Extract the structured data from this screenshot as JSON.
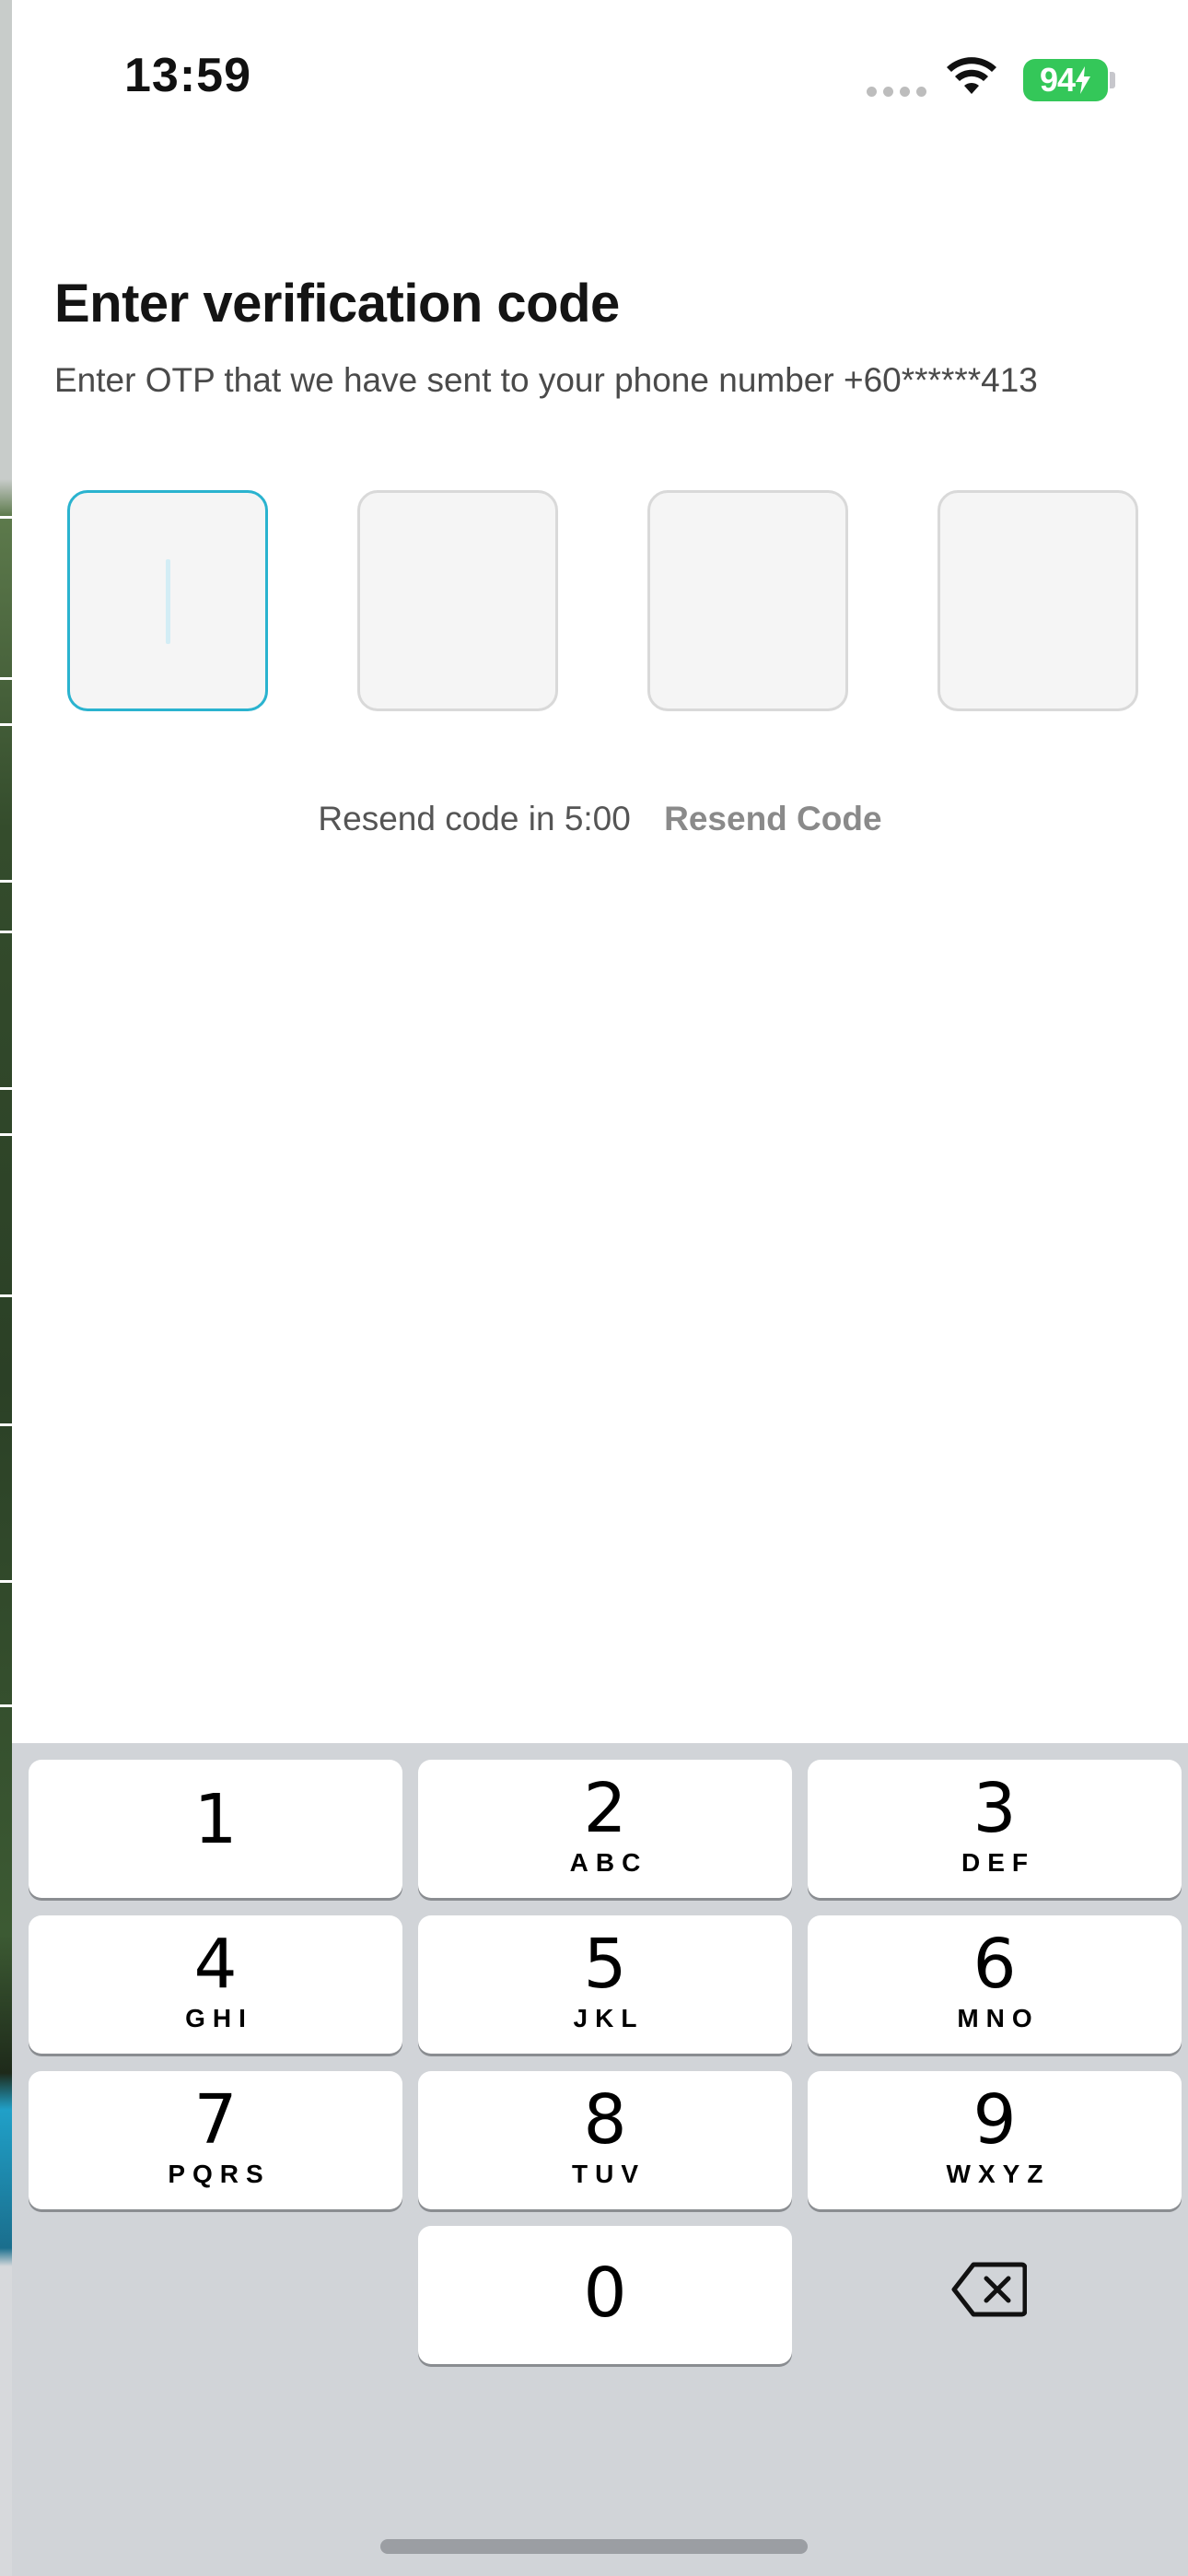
{
  "status_bar": {
    "time": "13:59",
    "battery": "94"
  },
  "page": {
    "title": "Enter verification code",
    "subtitle": "Enter OTP that we have sent to your phone number +60******413"
  },
  "otp": {
    "boxes": [
      "",
      "",
      "",
      ""
    ],
    "active_index": 0
  },
  "resend": {
    "timer_text": "Resend code in 5:00",
    "link": "Resend Code"
  },
  "keypad": {
    "keys": [
      {
        "digit": "1",
        "letters": ""
      },
      {
        "digit": "2",
        "letters": "ABC"
      },
      {
        "digit": "3",
        "letters": "DEF"
      },
      {
        "digit": "4",
        "letters": "GHI"
      },
      {
        "digit": "5",
        "letters": "JKL"
      },
      {
        "digit": "6",
        "letters": "MNO"
      },
      {
        "digit": "7",
        "letters": "PQRS"
      },
      {
        "digit": "8",
        "letters": "TUV"
      },
      {
        "digit": "9",
        "letters": "WXYZ"
      },
      {
        "digit": "0",
        "letters": ""
      }
    ],
    "delete_icon": "backspace-icon"
  },
  "colors": {
    "accent": "#2ab3cf",
    "battery": "#34c759",
    "keypad_bg": "#d1d4d8"
  }
}
